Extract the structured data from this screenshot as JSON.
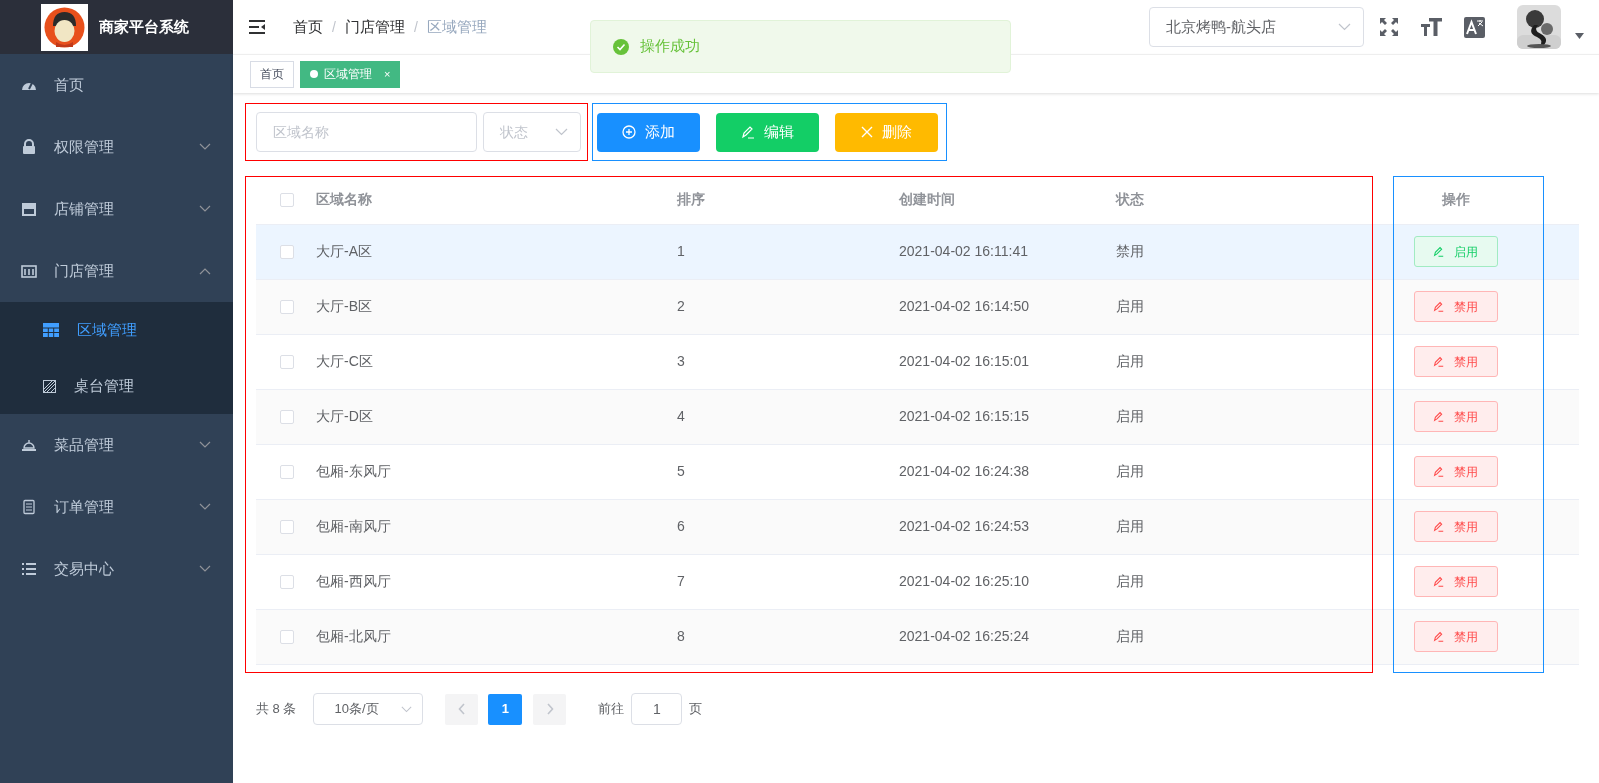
{
  "sidebar": {
    "brand": "商家平台系统",
    "items": [
      {
        "label": "首页",
        "selected": false
      },
      {
        "label": "权限管理",
        "selected": false,
        "expanded": false
      },
      {
        "label": "店铺管理",
        "selected": false,
        "expanded": false
      },
      {
        "label": "门店管理",
        "selected": false,
        "expanded": true,
        "children": [
          {
            "label": "区域管理",
            "selected": true
          },
          {
            "label": "桌台管理",
            "selected": false
          }
        ]
      },
      {
        "label": "菜品管理",
        "selected": false,
        "expanded": false
      },
      {
        "label": "订单管理",
        "selected": false,
        "expanded": false
      },
      {
        "label": "交易中心",
        "selected": false,
        "expanded": false
      }
    ]
  },
  "header": {
    "separator": "/",
    "breadcrumb": [
      {
        "label": "首页",
        "current": false
      },
      {
        "label": "门店管理",
        "current": false
      },
      {
        "label": "区域管理",
        "current": true
      }
    ],
    "store_select": {
      "value": "北京烤鸭-航头店"
    }
  },
  "tabs": [
    {
      "label": "首页",
      "selected": false
    },
    {
      "label": "区域管理",
      "selected": true,
      "close": "×"
    }
  ],
  "toast": {
    "message": "操作成功",
    "kind": "success"
  },
  "filters": {
    "name": {
      "placeholder": "区域名称"
    },
    "status": {
      "placeholder": "状态"
    }
  },
  "buttons": [
    {
      "label": "添加",
      "kind": "add"
    },
    {
      "label": "编辑",
      "kind": "edit"
    },
    {
      "label": "删除",
      "kind": "delete"
    }
  ],
  "table": {
    "header_checked": false,
    "columns": [
      "区域名称",
      "排序",
      "创建时间",
      "状态",
      "操作"
    ],
    "rows": [
      {
        "checked": false,
        "highlighted": true,
        "name": "大厅-A区",
        "sort": "1",
        "created": "2021-04-02 16:11:41",
        "status": "禁用",
        "action": {
          "label": "启用",
          "kind": "enable"
        }
      },
      {
        "checked": false,
        "highlighted": false,
        "name": "大厅-B区",
        "sort": "2",
        "created": "2021-04-02 16:14:50",
        "status": "启用",
        "action": {
          "label": "禁用",
          "kind": "disable"
        }
      },
      {
        "checked": false,
        "highlighted": false,
        "name": "大厅-C区",
        "sort": "3",
        "created": "2021-04-02 16:15:01",
        "status": "启用",
        "action": {
          "label": "禁用",
          "kind": "disable"
        }
      },
      {
        "checked": false,
        "highlighted": false,
        "name": "大厅-D区",
        "sort": "4",
        "created": "2021-04-02 16:15:15",
        "status": "启用",
        "action": {
          "label": "禁用",
          "kind": "disable"
        }
      },
      {
        "checked": false,
        "highlighted": false,
        "name": "包厢-东风厅",
        "sort": "5",
        "created": "2021-04-02 16:24:38",
        "status": "启用",
        "action": {
          "label": "禁用",
          "kind": "disable"
        }
      },
      {
        "checked": false,
        "highlighted": false,
        "name": "包厢-南风厅",
        "sort": "6",
        "created": "2021-04-02 16:24:53",
        "status": "启用",
        "action": {
          "label": "禁用",
          "kind": "disable"
        }
      },
      {
        "checked": false,
        "highlighted": false,
        "name": "包厢-西风厅",
        "sort": "7",
        "created": "2021-04-02 16:25:10",
        "status": "启用",
        "action": {
          "label": "禁用",
          "kind": "disable"
        }
      },
      {
        "checked": false,
        "highlighted": false,
        "name": "包厢-北风厅",
        "sort": "8",
        "created": "2021-04-02 16:25:24",
        "status": "启用",
        "action": {
          "label": "禁用",
          "kind": "disable"
        }
      }
    ]
  },
  "pagination": {
    "total": "共 8 条",
    "page_size": "10条/页",
    "prev_disabled": true,
    "next_disabled": true,
    "pages": [
      {
        "label": "1",
        "selected": true
      }
    ],
    "jump_label": "前往",
    "jump_value": "1",
    "jump_suffix": "页"
  }
}
